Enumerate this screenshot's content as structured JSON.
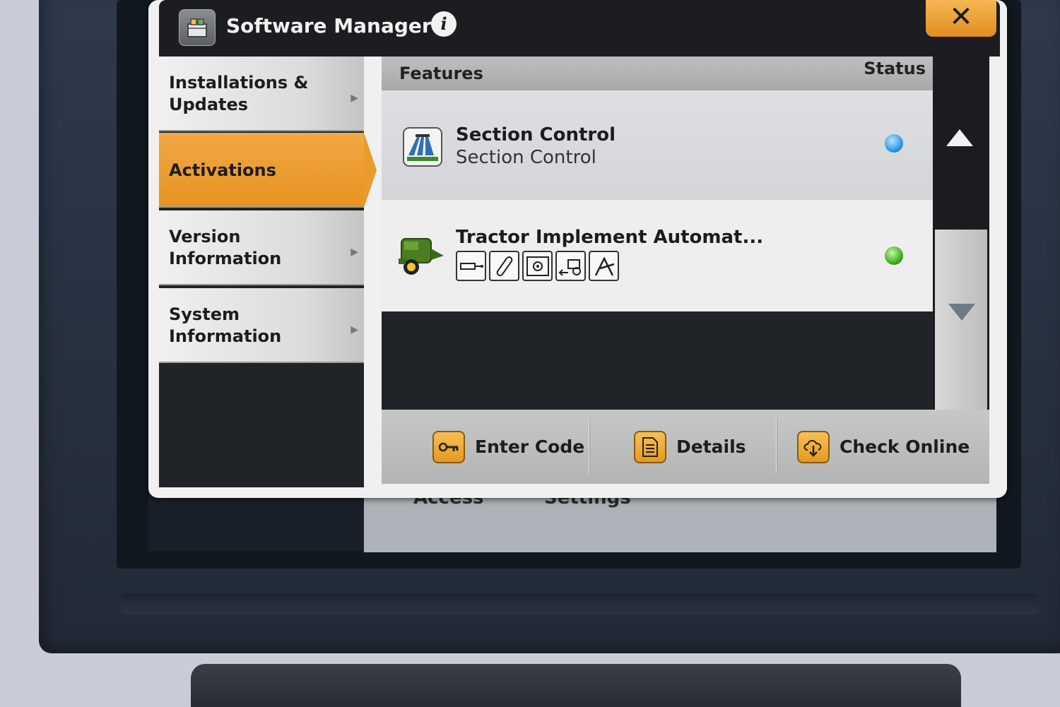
{
  "window": {
    "title": "Software Manager",
    "close_label": "✕"
  },
  "nav": {
    "items": [
      {
        "line1": "Installations &",
        "line2": "Updates",
        "active": false
      },
      {
        "line1": "Activations",
        "line2": "",
        "active": true
      },
      {
        "line1": "Version",
        "line2": "Information",
        "active": false
      },
      {
        "line1": "System",
        "line2": "Information",
        "active": false
      }
    ]
  },
  "table": {
    "col_features": "Features",
    "col_status": "Status",
    "rows": [
      {
        "name": "Section Control",
        "subtitle": "Section Control",
        "icon": "section-control-icon",
        "status_color": "#2e9be8"
      },
      {
        "name": "Tractor Implement Automat...",
        "subtitle": "",
        "icon": "baler-icon",
        "status_color": "#3fb023",
        "sub_icons": [
          "hydraulic-cylinder-icon",
          "rod-icon",
          "gear-box-icon",
          "tractor-reverse-icon",
          "implement-icon"
        ]
      }
    ]
  },
  "buttons": {
    "enter_code": "Enter Code",
    "details": "Details",
    "check_online": "Check Online"
  },
  "background_labels": {
    "left": "Access",
    "right": "Settings"
  },
  "colors": {
    "accent_orange": "#e99b2c",
    "title_bar": "#1c1d21"
  }
}
